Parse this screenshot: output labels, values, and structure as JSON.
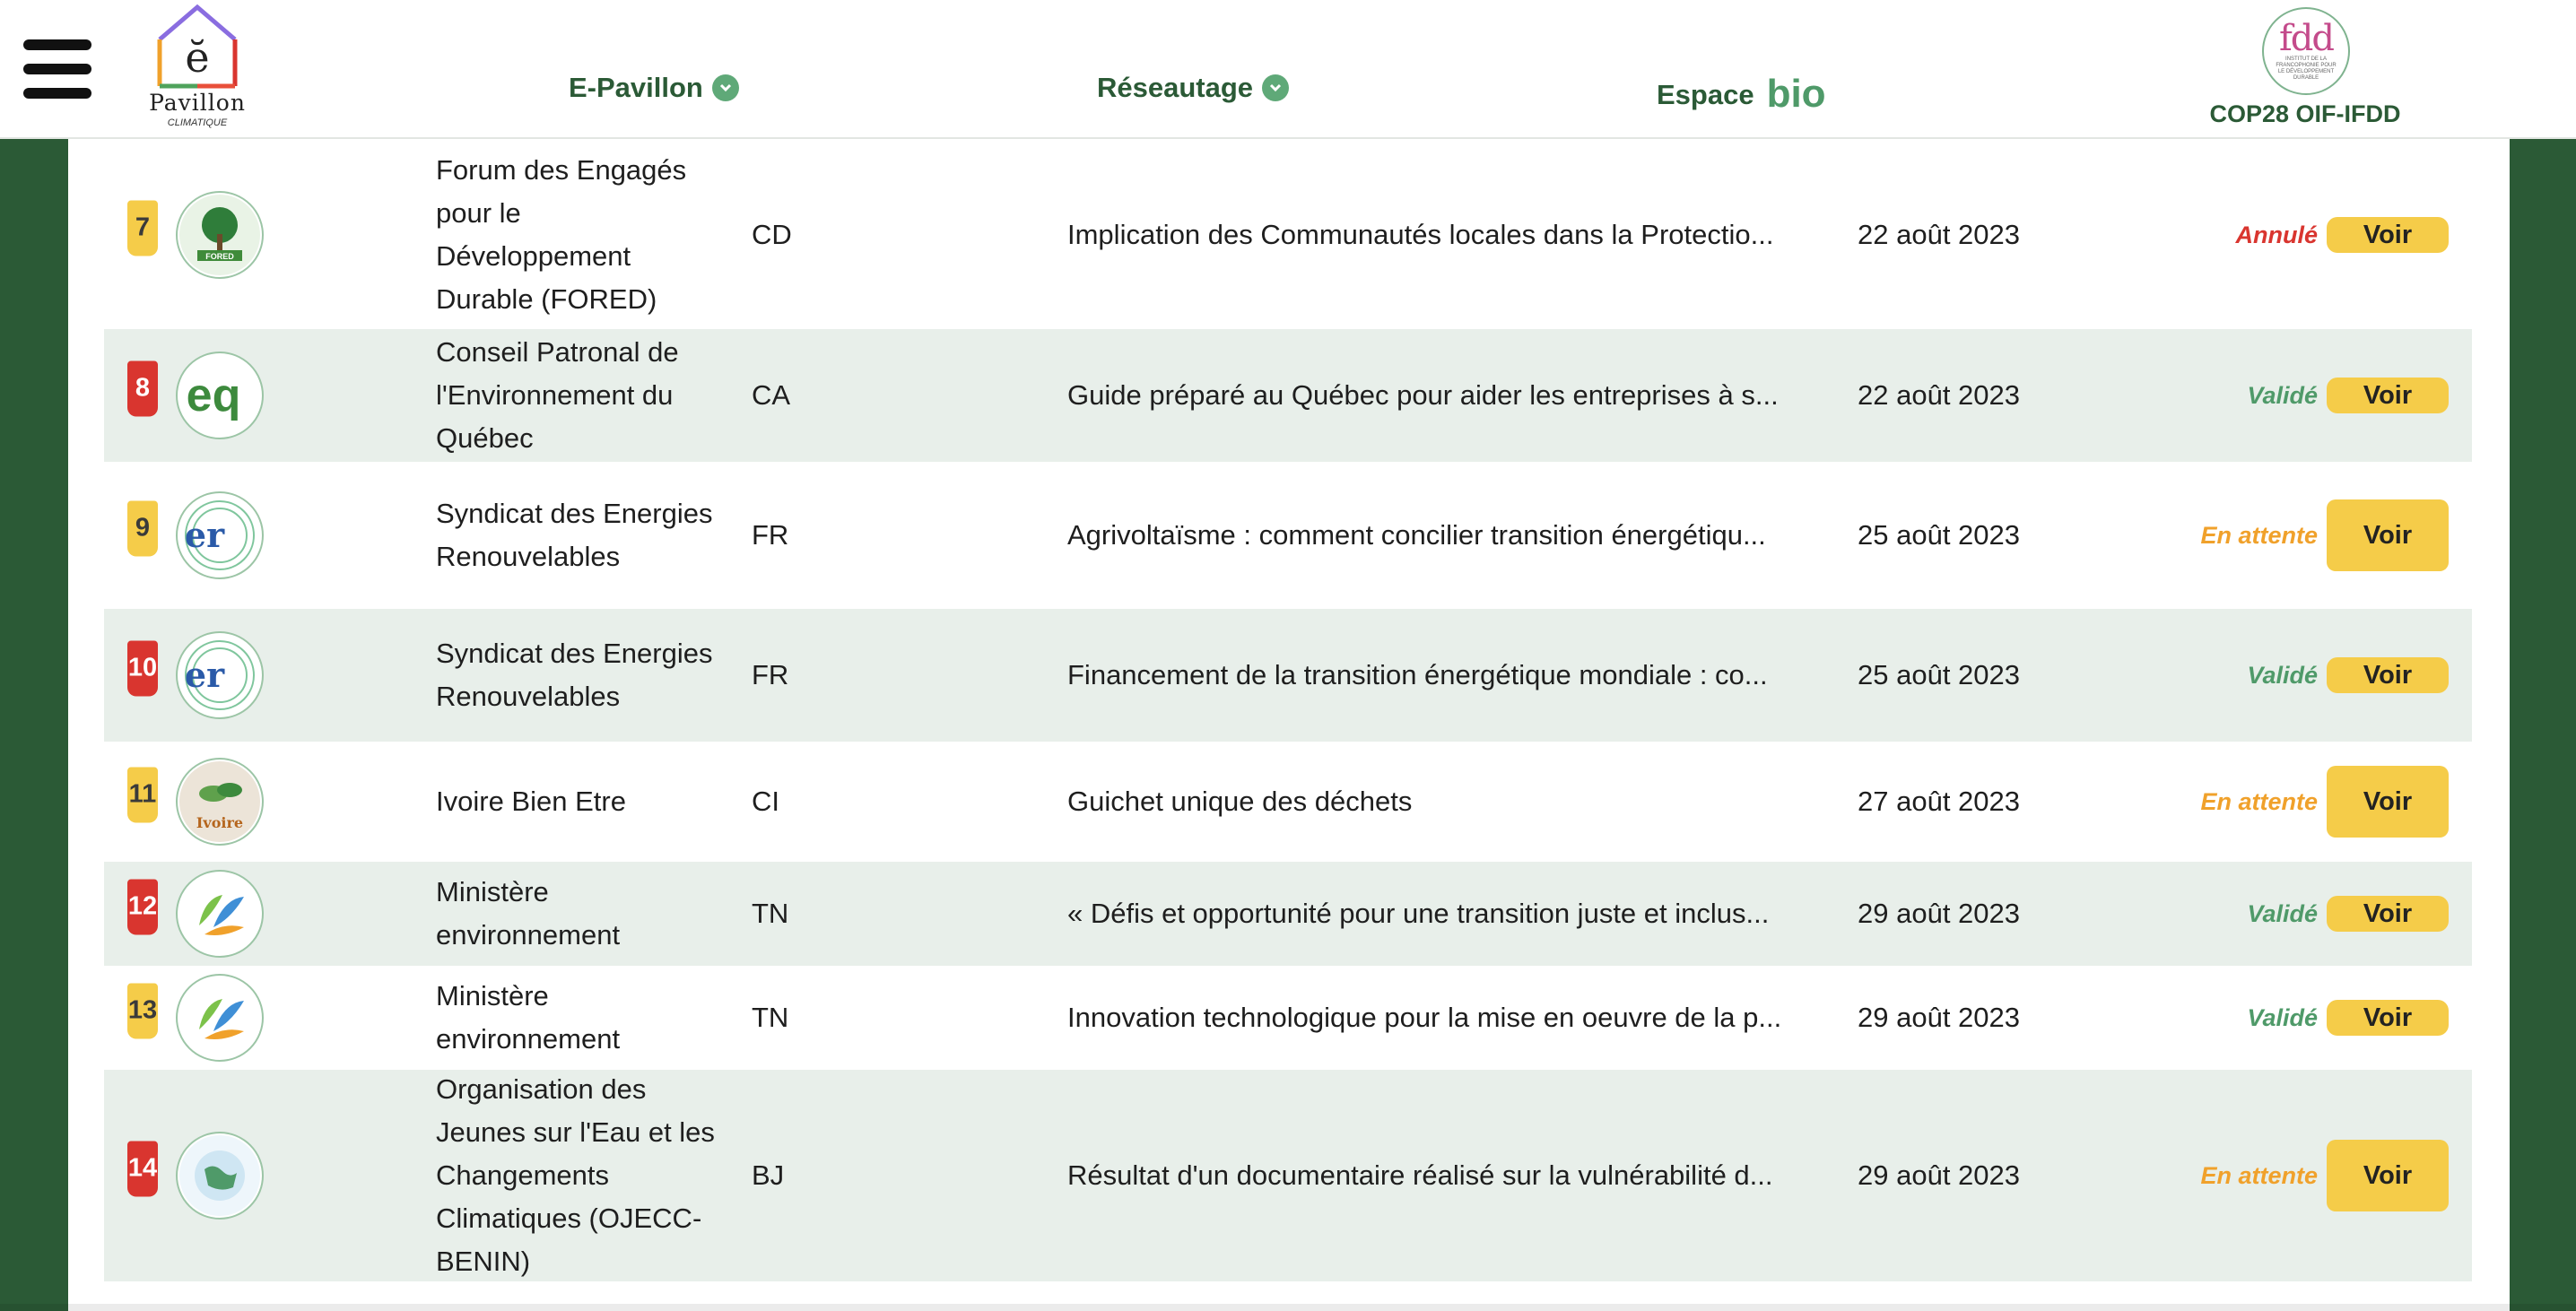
{
  "header": {
    "logo": {
      "glyph": "ĕ",
      "name": "Pavillon",
      "tagline": "CLIMATIQUE"
    },
    "nav": [
      {
        "label": "E-Pavillon",
        "has_check": true
      },
      {
        "label": "Réseautage",
        "has_check": true
      },
      {
        "label": "Espace",
        "suffix": "bio"
      }
    ],
    "partner": {
      "logo_text": "fdd",
      "logo_small": "INSTITUT DE LA FRANCOPHONIE POUR LE DÉVELOPPEMENT DURABLE",
      "label": "COP28 OIF-IFDD"
    }
  },
  "colors": {
    "brand_green": "#2b5a36",
    "row_alt": "#e8efea",
    "badge_yellow": "#f5cc49",
    "badge_red": "#d9352f",
    "status_valide": "#4f9a69",
    "status_attente": "#f0a12b",
    "status_annule": "#d9352f"
  },
  "rows": [
    {
      "num": "7",
      "badge": "yellow",
      "avatar": "fored-logo",
      "org": "Forum des Engagés pour le Développement Durable (FORED)",
      "country": "CD",
      "title": "Implication des Communautés locales dans la Protectio...",
      "date": "22 août 2023",
      "status": "Annulé",
      "status_kind": "annule",
      "action": "Voir"
    },
    {
      "num": "8",
      "badge": "red",
      "avatar": "cpeq-logo",
      "org": "Conseil Patronal de l'Environnement du Québec",
      "country": "CA",
      "title": "Guide préparé au Québec pour aider les entreprises à s...",
      "date": "22 août 2023",
      "status": "Validé",
      "status_kind": "valide",
      "action": "Voir"
    },
    {
      "num": "9",
      "badge": "yellow",
      "avatar": "ser-logo",
      "org": "Syndicat des Energies Renouvelables",
      "country": "FR",
      "title": "Agrivoltaïsme : comment concilier transition énergétiqu...",
      "date": "25 août 2023",
      "status": "En attente",
      "status_kind": "attente",
      "action": "Voir"
    },
    {
      "num": "10",
      "badge": "red",
      "avatar": "ser-logo",
      "org": "Syndicat des Energies Renouvelables",
      "country": "FR",
      "title": "Financement de la transition énergétique mondiale : co...",
      "date": "25 août 2023",
      "status": "Validé",
      "status_kind": "valide",
      "action": "Voir"
    },
    {
      "num": "11",
      "badge": "yellow",
      "avatar": "ivoire-logo",
      "org": "Ivoire Bien Etre",
      "country": "CI",
      "title": "Guichet unique des déchets",
      "date": "27 août 2023",
      "status": "En attente",
      "status_kind": "attente",
      "action": "Voir"
    },
    {
      "num": "12",
      "badge": "red",
      "avatar": "ministere-logo",
      "org": "Ministère environnement",
      "country": "TN",
      "title": "« Défis et opportunité pour une transition juste et inclus...",
      "date": "29 août 2023",
      "status": "Validé",
      "status_kind": "valide",
      "action": "Voir"
    },
    {
      "num": "13",
      "badge": "yellow",
      "avatar": "ministere-logo",
      "org": "Ministère environnement",
      "country": "TN",
      "title": "Innovation technologique pour la mise en oeuvre de la p...",
      "date": "29 août 2023",
      "status": "Validé",
      "status_kind": "valide",
      "action": "Voir"
    },
    {
      "num": "14",
      "badge": "red",
      "avatar": "ojecc-logo",
      "org": "Organisation des Jeunes sur l'Eau et les Changements Climatiques (OJECC-BENIN)",
      "country": "BJ",
      "title": "Résultat d'un documentaire réalisé sur la vulnérabilité d...",
      "date": "29 août 2023",
      "status": "En attente",
      "status_kind": "attente",
      "action": "Voir"
    }
  ]
}
